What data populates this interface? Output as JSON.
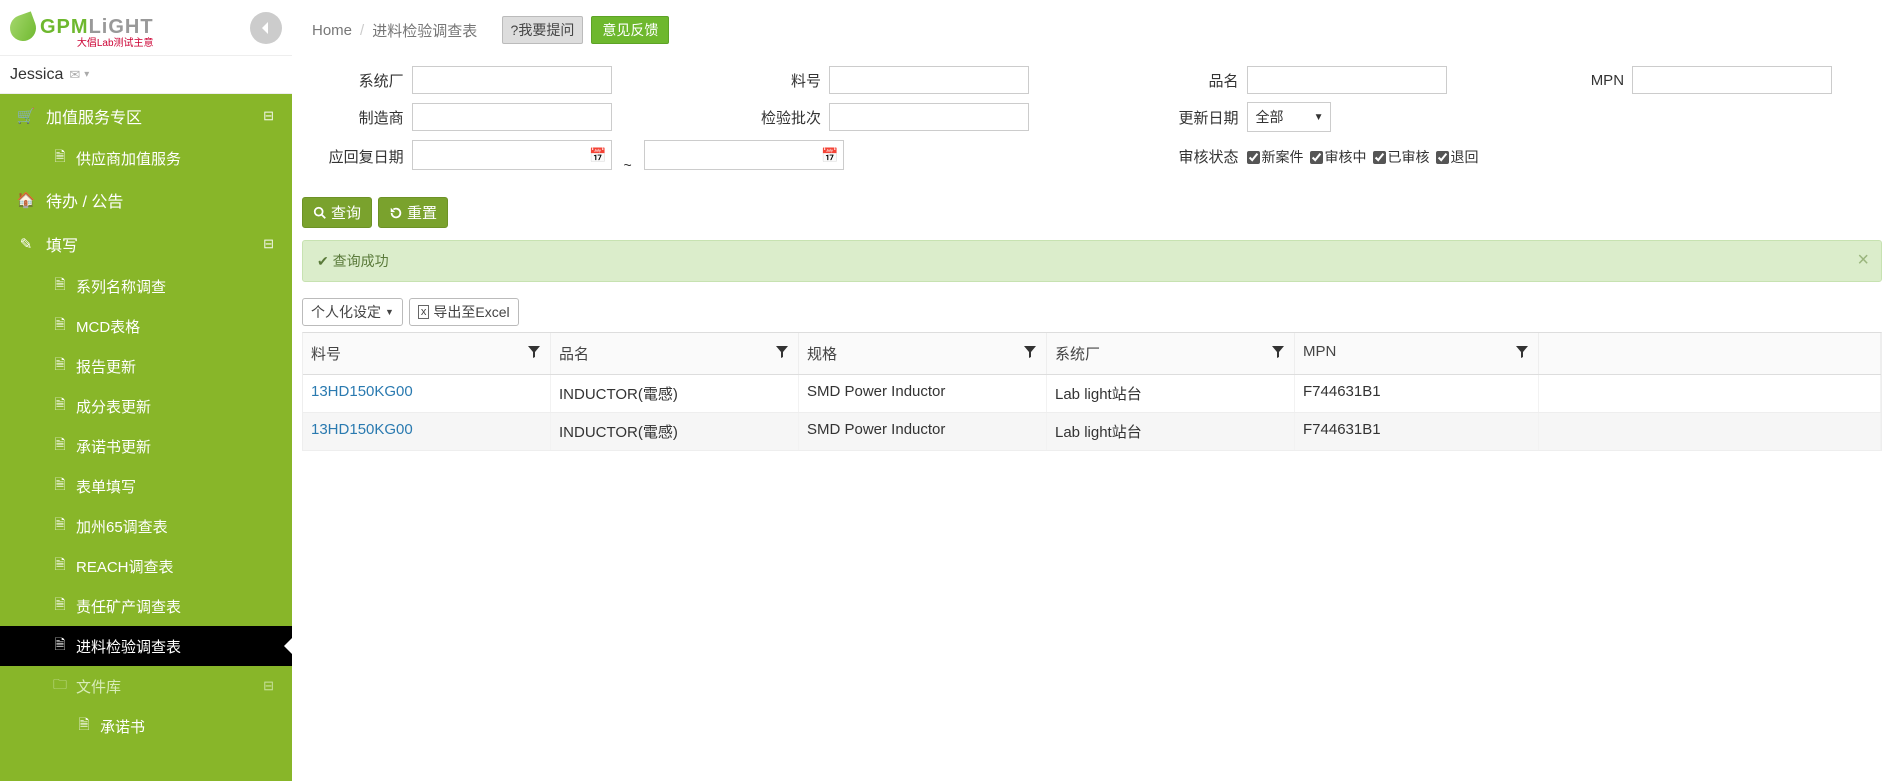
{
  "brand": {
    "name_colored_g": "GPM",
    "name_colored_grey": "LiGHT",
    "subtitle": "大倡Lab测试主意"
  },
  "user": {
    "name": "Jessica"
  },
  "collapse_tooltip": "collapse",
  "sidebar": {
    "vas": {
      "label": "加值服务专区",
      "items": [
        {
          "label": "供应商加值服务"
        }
      ]
    },
    "todo": {
      "label": "待办 / 公告"
    },
    "fill": {
      "label": "填写",
      "items": [
        {
          "label": "系列名称调查"
        },
        {
          "label": "MCD表格"
        },
        {
          "label": "报告更新"
        },
        {
          "label": "成分表更新"
        },
        {
          "label": "承诺书更新"
        },
        {
          "label": "表单填写"
        },
        {
          "label": "加州65调查表"
        },
        {
          "label": "REACH调查表"
        },
        {
          "label": "责任矿产调查表"
        },
        {
          "label": "进料检验调查表"
        },
        {
          "label": "文件库",
          "folder": true
        },
        {
          "label": "承诺书",
          "sub": true
        }
      ]
    }
  },
  "breadcrumb": {
    "home": "Home",
    "current": "进料检验调查表",
    "ask": "?我要提问",
    "feedback": "意见反馈"
  },
  "filters": {
    "system": {
      "label": "系统厂"
    },
    "partno": {
      "label": "料号"
    },
    "pname": {
      "label": "品名"
    },
    "mpn": {
      "label": "MPN"
    },
    "maker": {
      "label": "制造商"
    },
    "lot": {
      "label": "检验批次"
    },
    "upd": {
      "label": "更新日期",
      "selected": "全部"
    },
    "replydate": {
      "label": "应回复日期"
    },
    "status": {
      "label": "审核状态",
      "opts": [
        "新案件",
        "审核中",
        "已审核",
        "退回"
      ]
    }
  },
  "actions": {
    "search": "查询",
    "reset": "重置"
  },
  "alert": {
    "text": "查询成功"
  },
  "tools": {
    "personal": "个人化设定",
    "export": "导出至Excel"
  },
  "grid": {
    "cols": [
      "料号",
      "品名",
      "规格",
      "系统厂",
      "MPN"
    ],
    "rows": [
      {
        "c0": "13HD150KG00",
        "c1": "INDUCTOR(電感)",
        "c2": "SMD Power Inductor",
        "c3": "Lab light站台",
        "c4": "F744631B1"
      },
      {
        "c0": "13HD150KG00",
        "c1": "INDUCTOR(電感)",
        "c2": "SMD Power Inductor",
        "c3": "Lab light站台",
        "c4": "F744631B1"
      }
    ]
  }
}
